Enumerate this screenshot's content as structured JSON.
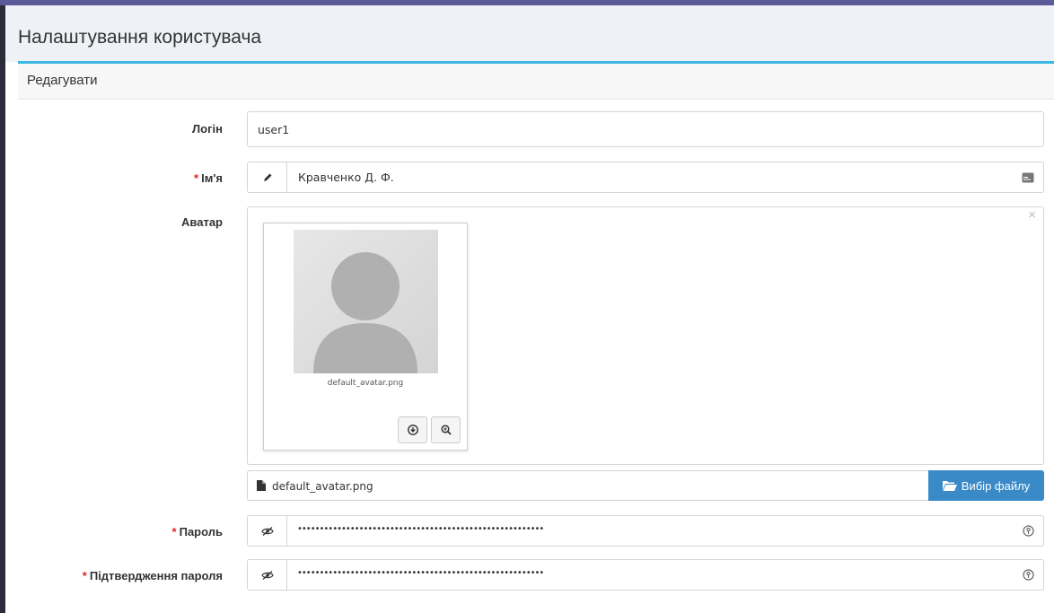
{
  "header": {
    "title": "Налаштування користувача"
  },
  "subheader": {
    "title": "Редагувати"
  },
  "form": {
    "login": {
      "label": "Логін",
      "value": "user1"
    },
    "name": {
      "required_mark": "*",
      "label": "Ім'я",
      "value": "Кравченко Д. Ф."
    },
    "avatar": {
      "label": "Аватар",
      "thumb_filename": "default_avatar.png",
      "file_value": "default_avatar.png",
      "choose_button_label": "Вибір файлу"
    },
    "password": {
      "required_mark": "*",
      "label": "Пароль",
      "masked_value": "••••••••••••••••••••••••••••••••••••••••••••••••••••••••"
    },
    "password_confirm": {
      "required_mark": "*",
      "label": "Підтвердження пароля",
      "masked_value": "••••••••••••••••••••••••••••••••••••••••••••••••••••••••"
    }
  },
  "icons": {
    "edit": "pencil-icon",
    "card": "id-card-icon",
    "close": "close-icon",
    "download": "download-icon",
    "zoom": "zoom-in-icon",
    "file": "file-icon",
    "folder": "folder-open-icon",
    "eye_toggle": "eye-slash-icon",
    "generate": "key-generate-icon"
  },
  "colors": {
    "accent": "#3db7e4",
    "button": "#3a8ac7",
    "required": "#e02424",
    "top_stripe": "#5b5b9a"
  }
}
